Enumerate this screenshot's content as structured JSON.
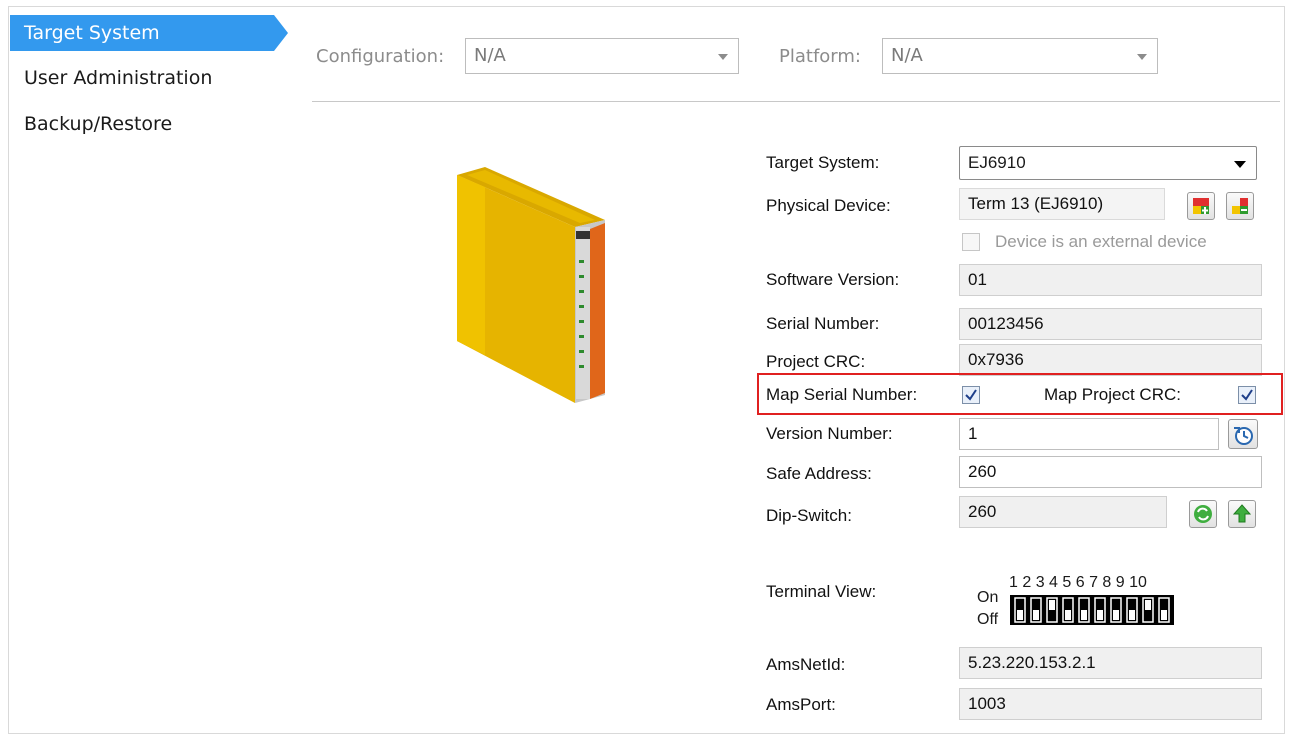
{
  "nav": {
    "items": [
      {
        "label": "Target System",
        "active": true
      },
      {
        "label": "User Administration",
        "active": false
      },
      {
        "label": "Backup/Restore",
        "active": false
      }
    ]
  },
  "config": {
    "configuration_label": "Configuration:",
    "configuration_value": "N/A",
    "platform_label": "Platform:",
    "platform_value": "N/A"
  },
  "form": {
    "target_system_label": "Target System:",
    "target_system_value": "EJ6910",
    "physical_device_label": "Physical Device:",
    "physical_device_value": "Term 13 (EJ6910)",
    "external_device_label": "Device is an external device",
    "external_device_checked": false,
    "software_version_label": "Software Version:",
    "software_version_value": "01",
    "serial_number_label": "Serial Number:",
    "serial_number_value": "00123456",
    "project_crc_label": "Project CRC:",
    "project_crc_value": "0x7936",
    "map_serial_label": "Map Serial Number:",
    "map_serial_checked": true,
    "map_crc_label": "Map Project CRC:",
    "map_crc_checked": true,
    "version_number_label": "Version Number:",
    "version_number_value": "1",
    "safe_address_label": "Safe Address:",
    "safe_address_value": "260",
    "dip_switch_label": "Dip-Switch:",
    "dip_switch_value": "260",
    "terminal_view_label": "Terminal View:",
    "dip_numbers": "1 2 3 4 5 6 7 8 9 10",
    "dip_on_label": "On",
    "dip_off_label": "Off",
    "dip_states": [
      false,
      false,
      true,
      false,
      false,
      false,
      false,
      false,
      true,
      false
    ],
    "amsnetid_label": "AmsNetId:",
    "amsnetid_value": "5.23.220.153.2.1",
    "amsport_label": "AmsPort:",
    "amsport_value": "1003"
  },
  "colors": {
    "nav_active": "#3399ee",
    "highlight_box": "#e02020",
    "device_body": "#e8b800",
    "device_front": "#e0661a"
  }
}
